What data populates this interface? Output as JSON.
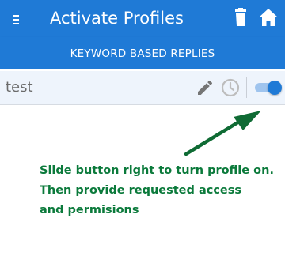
{
  "app_bar": {
    "title": "Activate Profiles",
    "background_color": "#1f7ad6",
    "menu_icon": "menu-icon",
    "actions": [
      {
        "icon": "trash-icon",
        "label": "Delete"
      },
      {
        "icon": "home-icon",
        "label": "Home"
      }
    ]
  },
  "tabs": [
    {
      "label": "KEYWORD BASED REPLIES",
      "selected": true
    }
  ],
  "profiles": [
    {
      "name": "test",
      "edit_icon": "pencil-icon",
      "schedule_icon": "clock-icon",
      "enabled": true
    }
  ],
  "hint": {
    "color": "#0b7a3b",
    "lines": [
      "Slide button right to turn profile on.",
      "Then provide requested access",
      "and permisions"
    ]
  }
}
